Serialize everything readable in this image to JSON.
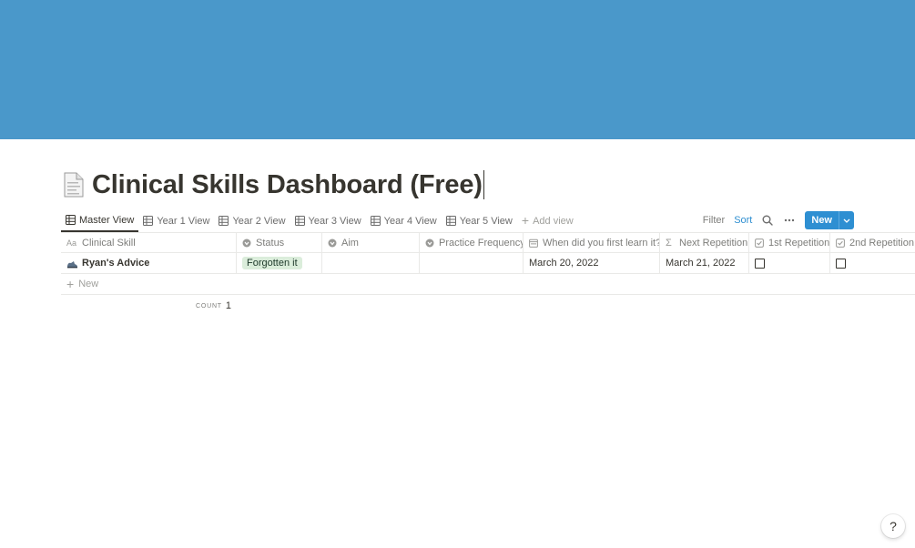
{
  "colors": {
    "cover": "#4a98ca",
    "accent": "#2e8fd2",
    "tag_bg": "#dbeddb",
    "text": "#37352f",
    "muted": "#7d7d7a"
  },
  "page": {
    "icon": "page-facing-up-icon",
    "title": "Clinical Skills Dashboard (Free)"
  },
  "views": {
    "tabs": [
      {
        "label": "Master View",
        "active": true
      },
      {
        "label": "Year 1 View",
        "active": false
      },
      {
        "label": "Year 2 View",
        "active": false
      },
      {
        "label": "Year 3 View",
        "active": false
      },
      {
        "label": "Year 4 View",
        "active": false
      },
      {
        "label": "Year 5 View",
        "active": false
      }
    ],
    "add_view": "Add view"
  },
  "toolbar": {
    "filter": "Filter",
    "sort": "Sort",
    "new": "New"
  },
  "table": {
    "columns": [
      {
        "label": "Clinical Skill",
        "icon": "title-aa-icon"
      },
      {
        "label": "Status",
        "icon": "select-icon"
      },
      {
        "label": "Aim",
        "icon": "select-icon"
      },
      {
        "label": "Practice Frequency",
        "icon": "select-icon"
      },
      {
        "label": "When did you first learn it?",
        "icon": "calendar-icon"
      },
      {
        "label": "Next Repetition",
        "icon": "sigma-icon"
      },
      {
        "label": "1st Repetition",
        "icon": "checkbox-icon"
      },
      {
        "label": "2nd Repetition",
        "icon": "checkbox-icon"
      }
    ],
    "rows": [
      {
        "name": "Ryan's Advice",
        "status": "Forgotten it",
        "aim": "",
        "frequency": "",
        "first_learn": "March 20, 2022",
        "next_repetition": "March 21, 2022",
        "rep1": false,
        "rep2": false
      }
    ],
    "new_label": "New",
    "count_label": "COUNT",
    "count_value": "1"
  },
  "help": "?"
}
